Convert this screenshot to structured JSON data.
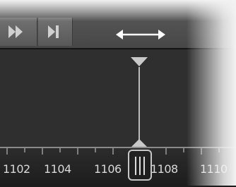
{
  "toolbar": {
    "buttons": [
      {
        "name": "fast-forward",
        "icon": "fast-forward-icon"
      },
      {
        "name": "skip-to-end",
        "icon": "skip-to-end-icon"
      }
    ],
    "drag_handle_icon": "horizontal-resize-icon"
  },
  "timeline": {
    "ruler_labels": [
      "1102",
      "1104",
      "1106",
      "1108",
      "1110"
    ]
  },
  "colors": {
    "toolbar": "#505050",
    "panel": "#2f2f2f",
    "ruler": "#242424",
    "playhead": "#bdbdbd",
    "label": "#d9d9d9"
  }
}
